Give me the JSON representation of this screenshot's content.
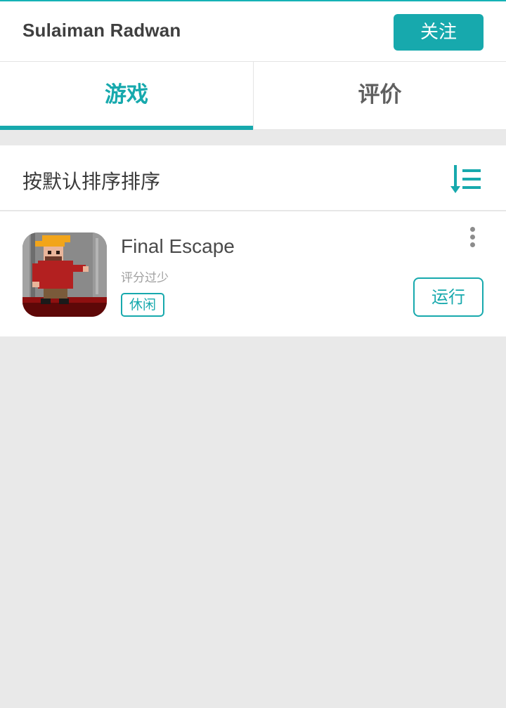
{
  "header": {
    "user_name": "Sulaiman Radwan",
    "follow_label": "关注"
  },
  "tabs": [
    {
      "label": "游戏",
      "active": true
    },
    {
      "label": "评价",
      "active": false
    }
  ],
  "sort": {
    "label": "按默认排序排序",
    "icon": "sort-list-icon"
  },
  "games": [
    {
      "title": "Final Escape",
      "rating_text": "评分过少",
      "tag": "休闲",
      "action_label": "运行",
      "icon": "game-character-icon"
    }
  ],
  "colors": {
    "accent": "#17a9ad",
    "background": "#e9e9e9",
    "surface": "#ffffff"
  }
}
